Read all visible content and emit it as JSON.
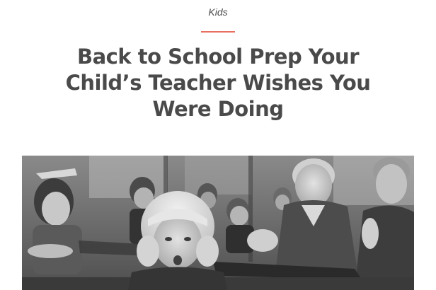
{
  "article": {
    "category": "Kids",
    "title": "Back to School Prep Your Child’s Teacher Wishes You Were Doing"
  },
  "colors": {
    "accent": "#e8705f",
    "title_text": "#4a4a4a",
    "category_text": "#4d4d4d"
  },
  "hero_image": {
    "subject": "black-and-white photo of children seated at classroom desks"
  }
}
